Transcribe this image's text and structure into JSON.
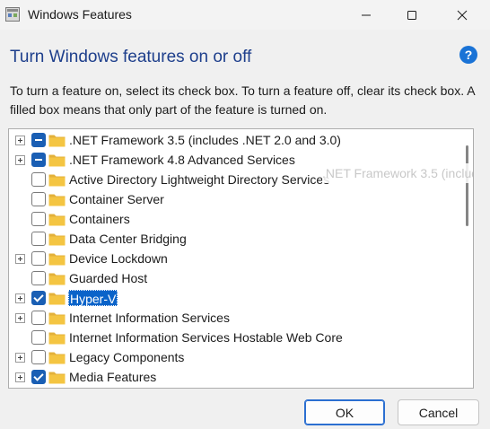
{
  "window": {
    "title": "Windows Features",
    "minimize_icon": "minimize-icon",
    "maximize_icon": "maximize-icon",
    "close_icon": "close-icon"
  },
  "heading": "Turn Windows features on or off",
  "help_icon_label": "?",
  "description": "To turn a feature on, select its check box. To turn a feature off, clear its check box. A filled box means that only part of the feature is turned on.",
  "tooltip_ghost": ".NET Framework 3.5 (includes",
  "features": [
    {
      "label": ".NET Framework 3.5 (includes .NET 2.0 and 3.0)",
      "expandable": true,
      "state": "partial"
    },
    {
      "label": ".NET Framework 4.8 Advanced Services",
      "expandable": true,
      "state": "partial"
    },
    {
      "label": "Active Directory Lightweight Directory Services",
      "expandable": false,
      "state": "unchecked"
    },
    {
      "label": "Container Server",
      "expandable": false,
      "state": "unchecked"
    },
    {
      "label": "Containers",
      "expandable": false,
      "state": "unchecked"
    },
    {
      "label": "Data Center Bridging",
      "expandable": false,
      "state": "unchecked"
    },
    {
      "label": "Device Lockdown",
      "expandable": true,
      "state": "unchecked"
    },
    {
      "label": "Guarded Host",
      "expandable": false,
      "state": "unchecked"
    },
    {
      "label": "Hyper-V",
      "expandable": true,
      "state": "checked",
      "selected": true
    },
    {
      "label": "Internet Information Services",
      "expandable": true,
      "state": "unchecked"
    },
    {
      "label": "Internet Information Services Hostable Web Core",
      "expandable": false,
      "state": "unchecked"
    },
    {
      "label": "Legacy Components",
      "expandable": true,
      "state": "unchecked"
    },
    {
      "label": "Media Features",
      "expandable": true,
      "state": "checked"
    }
  ],
  "buttons": {
    "ok": "OK",
    "cancel": "Cancel"
  },
  "colors": {
    "accent": "#1a5fb4",
    "selection": "#0a63c9",
    "heading": "#1e3f8c",
    "folder": "#f4c542"
  }
}
